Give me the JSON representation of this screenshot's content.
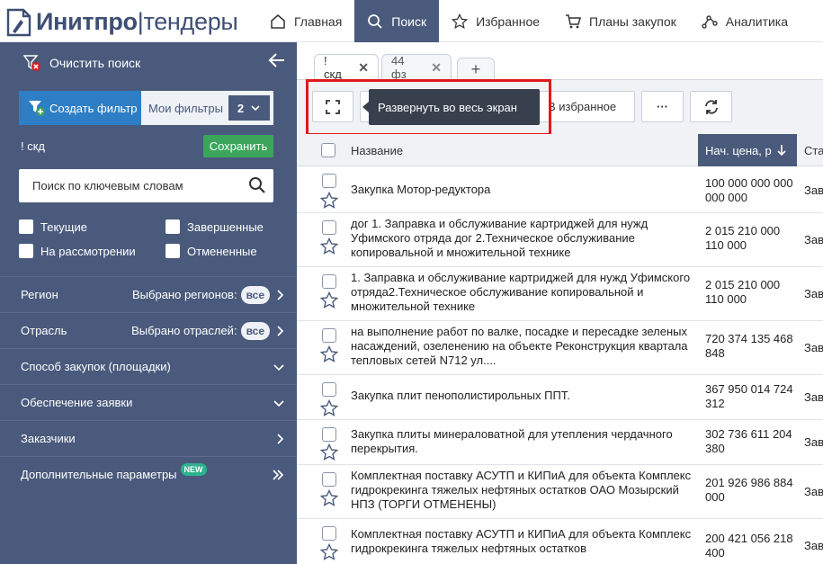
{
  "brand": {
    "name_bold": "Инитпро",
    "name_rest": "тендеры"
  },
  "nav": [
    {
      "label": "Главная",
      "icon": "home-icon"
    },
    {
      "label": "Поиск",
      "icon": "search-icon",
      "active": true
    },
    {
      "label": "Избранное",
      "icon": "star-icon"
    },
    {
      "label": "Планы закупок",
      "icon": "cart-icon"
    },
    {
      "label": "Аналитика",
      "icon": "analytics-icon"
    }
  ],
  "sidebar": {
    "clear_search": "Очистить поиск",
    "create_filter": "Создать фильтр",
    "my_filters": "Мои фильтры",
    "my_filters_count": "2",
    "filter_name": "! скд",
    "save": "Сохранить",
    "search_placeholder": "Поиск по ключевым словам",
    "checkboxes": [
      "Текущие",
      "Завершенные",
      "На рассмотрении",
      "Отмененные"
    ],
    "region": {
      "label": "Регион",
      "selected": "Выбрано регионов:",
      "pill": "все"
    },
    "industry": {
      "label": "Отрасль",
      "selected": "Выбрано отраслей:",
      "pill": "все"
    },
    "method": "Способ закупок (площадки)",
    "security": "Обеспечение заявки",
    "customers": "Заказчики",
    "extra": "Дополнительные параметры",
    "new_badge": "NEW"
  },
  "tabs": [
    {
      "label": "! скд",
      "close": "✕"
    },
    {
      "label": "44 фз",
      "close": "✕"
    },
    {
      "label": "+"
    }
  ],
  "toolbar": {
    "tooltip": "Развернуть во весь экран",
    "favorites": "В избранное",
    "more": "···"
  },
  "table": {
    "col_name": "Название",
    "col_price": "Нач. цена, р",
    "col_status": "Ста",
    "rows": [
      {
        "name": "Закупка Мотор-редуктора",
        "price": "100 000 000 000 000 000",
        "status": "Зав"
      },
      {
        "name": "дог 1. Заправка и обслуживание картриджей для нужд Уфимского отряда дог 2.Техническое обслуживание копировальной и множительной технике",
        "price": "2 015 210 000 110 000",
        "status": "Зав"
      },
      {
        "name": "1. Заправка и обслуживание картриджей для нужд Уфимского отряда2.Техническое обслуживание копировальной и множительной технике",
        "price": "2 015 210 000 110 000",
        "status": "Зав"
      },
      {
        "name": "на выполнение работ по валке, посадке и пересадке зеленых насаждений, озеленению на объекте Реконструкция квартала тепловых сетей N712 ул....",
        "price": "720 374 135 468 848",
        "status": "Зав"
      },
      {
        "name": "Закупка плит пенополистирольных ППТ.",
        "price": "367 950 014 724 312",
        "status": "Зав"
      },
      {
        "name": "Закупка плиты минераловатной для утепления чердачного перекрытия.",
        "price": "302 736 611 204 380",
        "status": "Зав"
      },
      {
        "name": "Комплектная поставку АСУТП и КИПиА для объекта Комплекс гидрокрекинга тяжелых нефтяных остатков ОАО Мозырский НПЗ (ТОРГИ ОТМЕНЕНЫ)",
        "price": "201 926 986 884 000",
        "status": "Зав"
      },
      {
        "name": "Комплектная поставку АСУТП и КИПиА для объекта Комплекс гидрокрекинга тяжелых нефтяных остатков",
        "price": "200 421 056 218 400",
        "status": "Зав"
      }
    ]
  }
}
